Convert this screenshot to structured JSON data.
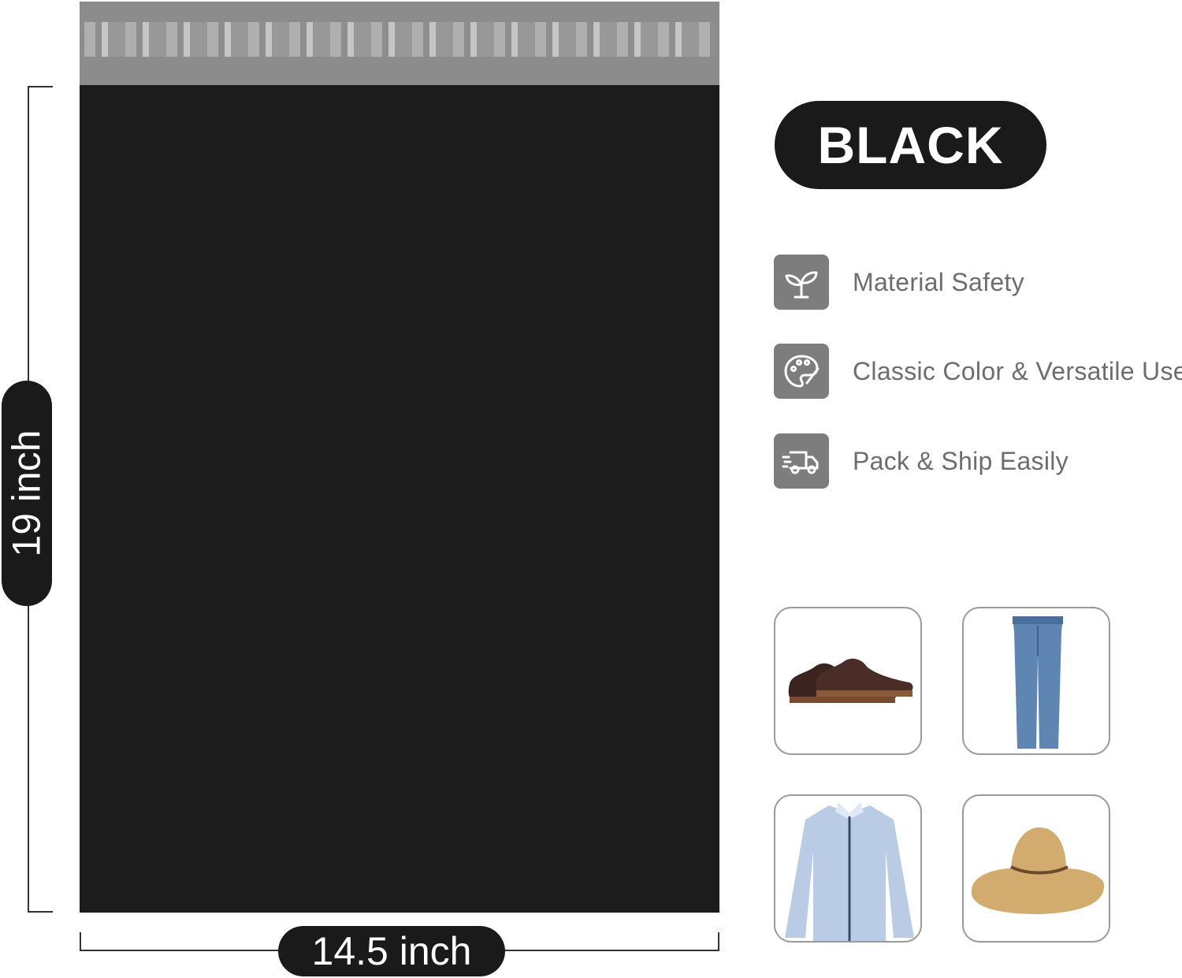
{
  "dimensions": {
    "height_label": "19 inch",
    "width_label": "14.5 inch"
  },
  "color_badge": "BLACK",
  "features": [
    {
      "icon": "sprout-icon",
      "label": "Material Safety"
    },
    {
      "icon": "palette-icon",
      "label": "Classic Color & Versatile Use"
    },
    {
      "icon": "delivery-truck-icon",
      "label": "Pack & Ship Easily"
    }
  ],
  "use_examples": [
    "shoes-image",
    "jeans-image",
    "shirt-image",
    "hat-image"
  ],
  "colors": {
    "mailer": "#1c1c1c",
    "seal_strip": "#8c8c8c",
    "icon_bg": "#7d7d7d",
    "feature_text": "#6d6d6d"
  }
}
